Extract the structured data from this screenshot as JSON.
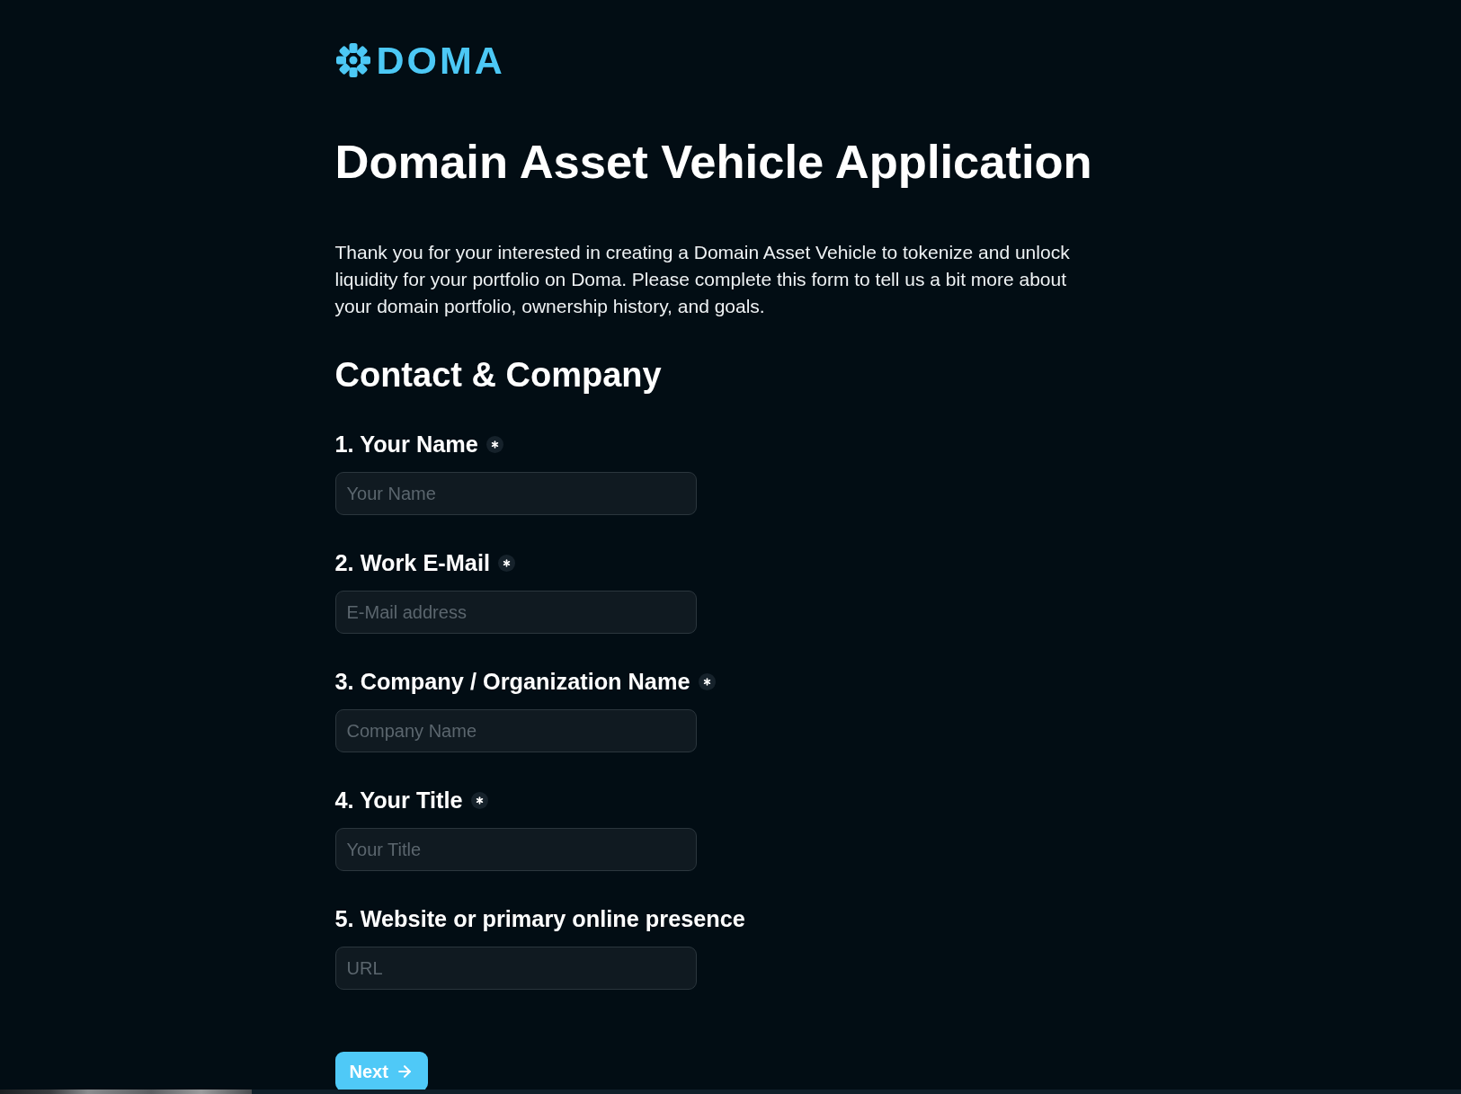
{
  "logo": {
    "text": "DOMA"
  },
  "title": "Domain Asset Vehicle Application",
  "intro": "Thank you for your interested in creating a Domain Asset Vehicle to tokenize and unlock liquidity for your portfolio on Doma. Please complete this form to tell us a bit more about your domain portfolio, ownership history, and goals.",
  "section": {
    "title": "Contact & Company",
    "fields": [
      {
        "label": "1. Your Name",
        "required": true,
        "placeholder": "Your Name"
      },
      {
        "label": "2. Work E-Mail",
        "required": true,
        "placeholder": "E-Mail address"
      },
      {
        "label": "3. Company / Organization Name",
        "required": true,
        "placeholder": "Company Name"
      },
      {
        "label": "4. Your Title",
        "required": true,
        "placeholder": "Your Title"
      },
      {
        "label": "5. Website or primary online presence",
        "required": false,
        "placeholder": "URL"
      }
    ]
  },
  "next_button": {
    "label": "Next"
  }
}
